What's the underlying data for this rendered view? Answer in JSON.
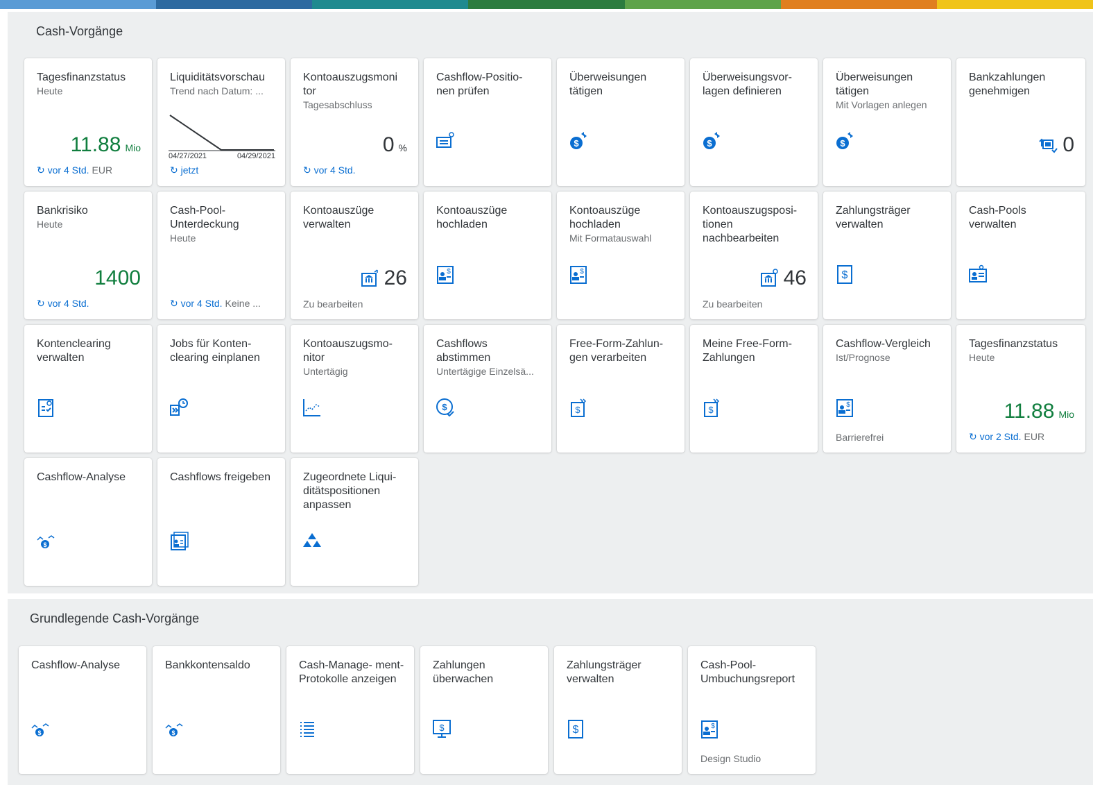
{
  "top_bar_colors": [
    "#5a9bd5",
    "#2e6aa0",
    "#1f8a8f",
    "#2c7c3f",
    "#5ea34a",
    "#e07f1f",
    "#f0c419"
  ],
  "sections": [
    {
      "title": "Cash-Vorgänge",
      "tiles": [
        {
          "title": "Tagesfinanzstatus",
          "subtitle": "Heute",
          "kpi": "11.88",
          "scale": "Mio",
          "refresh": "vor 4 Std.",
          "footer": "EUR",
          "icon": ""
        },
        {
          "title": "Liquiditätsvorschau",
          "subtitle": "Trend nach Datum: ...",
          "chart_start": "04/27/2021",
          "chart_end": "04/29/2021",
          "refresh": "jetzt",
          "icon": "line-chart"
        },
        {
          "title": "Kontoauszugsmoni tor",
          "subtitle": "Tagesabschluss",
          "kpi": "0",
          "scale": "%",
          "refresh": "vor 4 Std.",
          "footer": ""
        },
        {
          "title": "Cashflow-Positio- nen prüfen",
          "subtitle": "",
          "icon": "document-search-icon"
        },
        {
          "title": "Überweisungen tätigen",
          "subtitle": "",
          "icon": "money-transfer-icon"
        },
        {
          "title": "Überweisungsvor- lagen definieren",
          "subtitle": "",
          "icon": "money-transfer-icon"
        },
        {
          "title": "Überweisungen tätigen",
          "subtitle": "Mit Vorlagen anlegen",
          "icon": "money-transfer-icon"
        },
        {
          "title": "Bankzahlungen genehmigen",
          "subtitle": "",
          "kpi": "0",
          "icon": "approve-payments-icon"
        },
        {
          "title": "Bankrisiko",
          "subtitle": "Heute",
          "kpi": "1400",
          "refresh": "vor 4 Std."
        },
        {
          "title": "Cash-Pool- Unterdeckung",
          "subtitle": "Heute",
          "refresh": "vor 4 Std.",
          "footer": "Keine ..."
        },
        {
          "title": "Kontoauszüge verwalten",
          "subtitle": "",
          "kpi": "26",
          "footer": "Zu bearbeiten",
          "icon": "bank-statement-icon"
        },
        {
          "title": "Kontoauszüge hochladen",
          "subtitle": "",
          "icon": "upload-statement-icon"
        },
        {
          "title": "Kontoauszüge hochladen",
          "subtitle": "Mit Formatauswahl",
          "icon": "upload-statement-icon"
        },
        {
          "title": "Kontoauszugsposi- tionen nachbearbeiten",
          "subtitle": "",
          "kpi": "46",
          "footer": "Zu bearbeiten",
          "icon": "bank-statement-icon"
        },
        {
          "title": "Zahlungsträger verwalten",
          "subtitle": "",
          "icon": "dollar-doc-icon"
        },
        {
          "title": "Cash-Pools verwalten",
          "subtitle": "",
          "icon": "id-card-icon"
        },
        {
          "title": "Kontenclearing verwalten",
          "subtitle": "",
          "icon": "clearing-doc-icon"
        },
        {
          "title": "Jobs für Konten- clearing einplanen",
          "subtitle": "",
          "icon": "schedule-job-icon"
        },
        {
          "title": "Kontoauszugsmo- nitor",
          "subtitle": "Untertägig",
          "icon": "trend-chart-icon"
        },
        {
          "title": "Cashflows abstimmen",
          "subtitle": "Untertägige Einzelsä...",
          "icon": "dollar-check-icon"
        },
        {
          "title": "Free-Form-Zahlun- gen verarbeiten",
          "subtitle": "",
          "icon": "forward-payment-icon"
        },
        {
          "title": "Meine Free-Form- Zahlungen",
          "subtitle": "",
          "icon": "forward-payment-icon"
        },
        {
          "title": "Cashflow-Vergleich",
          "subtitle": "Ist/Prognose",
          "footer": "Barrierefrei",
          "icon": "upload-statement-icon"
        },
        {
          "title": "Tagesfinanzstatus",
          "subtitle": "Heute",
          "kpi": "11.88",
          "scale": "Mio",
          "refresh": "vor 2 Std.",
          "footer": "EUR"
        },
        {
          "title": "Cashflow-Analyse",
          "subtitle": "",
          "icon": "cashflow-analysis-icon"
        },
        {
          "title": "Cashflows freigeben",
          "subtitle": "",
          "icon": "release-doc-icon"
        },
        {
          "title": "Zugeordnete Liqui- ditätspositionen anpassen",
          "subtitle": "",
          "icon": "hierarchy-icon"
        }
      ]
    },
    {
      "title": "Grundlegende Cash-Vorgänge",
      "tiles": [
        {
          "title": "Cashflow-Analyse",
          "subtitle": "",
          "icon": "cashflow-analysis-icon"
        },
        {
          "title": "Bankkontensaldo",
          "subtitle": "",
          "icon": "cashflow-analysis-icon"
        },
        {
          "title": "Cash-Manage- ment-Protokolle anzeigen",
          "subtitle": "",
          "icon": "list-icon"
        },
        {
          "title": "Zahlungen überwachen",
          "subtitle": "",
          "icon": "monitor-dollar-icon"
        },
        {
          "title": "Zahlungsträger verwalten",
          "subtitle": "",
          "icon": "dollar-doc-icon"
        },
        {
          "title": "Cash-Pool- Umbuchungsreport",
          "subtitle": "",
          "footer": "Design Studio",
          "icon": "upload-statement-icon"
        }
      ]
    }
  ]
}
